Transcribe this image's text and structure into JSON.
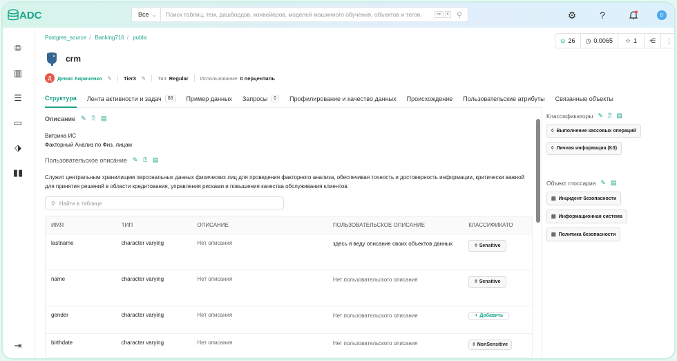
{
  "app": {
    "logo": "ADC"
  },
  "search": {
    "scope": "Все",
    "placeholder": "Поиск таблиц, тем, дашбордов, конвейеров, моделей машинного обучения, объектов и тегов.",
    "kbd1": "ctrl",
    "kbd2": "K"
  },
  "user": {
    "initial": "D"
  },
  "breadcrumb": [
    "Postgres_source",
    "Banking716",
    "public"
  ],
  "entity": {
    "name": "crm",
    "owner_initial": "Д",
    "owner": "Денис Кириченко",
    "tier": "Tier3",
    "type_label": "Тип:",
    "type": "Regular",
    "usage_label": "Использование:",
    "usage": "0 перцентиль"
  },
  "stats": {
    "views": "26",
    "freshness": "0.0065",
    "stars": "1"
  },
  "tabs": [
    {
      "label": "Структура"
    },
    {
      "label": "Лента активности и задач",
      "badge": "88"
    },
    {
      "label": "Пример данных"
    },
    {
      "label": "Запросы",
      "badge": "0"
    },
    {
      "label": "Профилирование и качество данных"
    },
    {
      "label": "Происхождение"
    },
    {
      "label": "Пользовательские атрибуты"
    },
    {
      "label": "Связанные объекты"
    }
  ],
  "description": {
    "title": "Описание",
    "lines": [
      "Витрина ИС",
      "Факторный Анализ по Физ. лицам"
    ]
  },
  "custom_description": {
    "title": "Пользовательское описание",
    "text": "Служит центральным хранилищем персональных данных физических лиц для проведения факторного анализа, обеспечивая точность и достоверность информации, критически важной для принятия решений в области кредитования, управления рисками и повышения качества обслуживания клиентов."
  },
  "table": {
    "search_placeholder": "Найти в таблице",
    "headers": [
      "ИМЯ",
      "ТИП",
      "ОПИСАНИЕ",
      "ПОЛЬЗОВАТЕЛЬСКОЕ ОПИСАНИЕ",
      "КЛАССИФИКАТО"
    ],
    "rows": [
      {
        "name": "lastname",
        "type": "character varying",
        "desc": "Нет описания",
        "udesc": "здесь я веду описание своих объектов данных",
        "tag": "Sensitive"
      },
      {
        "name": "name",
        "type": "character varying",
        "desc": "Нет описания",
        "udesc": "Нет пользовательского описания",
        "tag": "Sensitive"
      },
      {
        "name": "gender",
        "type": "character varying",
        "desc": "Нет описания",
        "udesc": "Нет пользовательского описания",
        "add": "Добавить"
      },
      {
        "name": "birthdate",
        "type": "character varying",
        "desc": "Нет описания",
        "udesc": "Нет пользовательского описания",
        "tag": "NonSensitive"
      }
    ]
  },
  "right": {
    "classifiers_title": "Классификаторы",
    "classifiers": [
      "Выполнение кассовых операций",
      "Личная информация (КЗ)"
    ],
    "glossary_title": "Объект глоссария",
    "glossary": [
      "Инцидент безопасности",
      "Информационная система",
      "Политика безопасности"
    ]
  },
  "colors": {
    "accent": "#1aa38a"
  }
}
